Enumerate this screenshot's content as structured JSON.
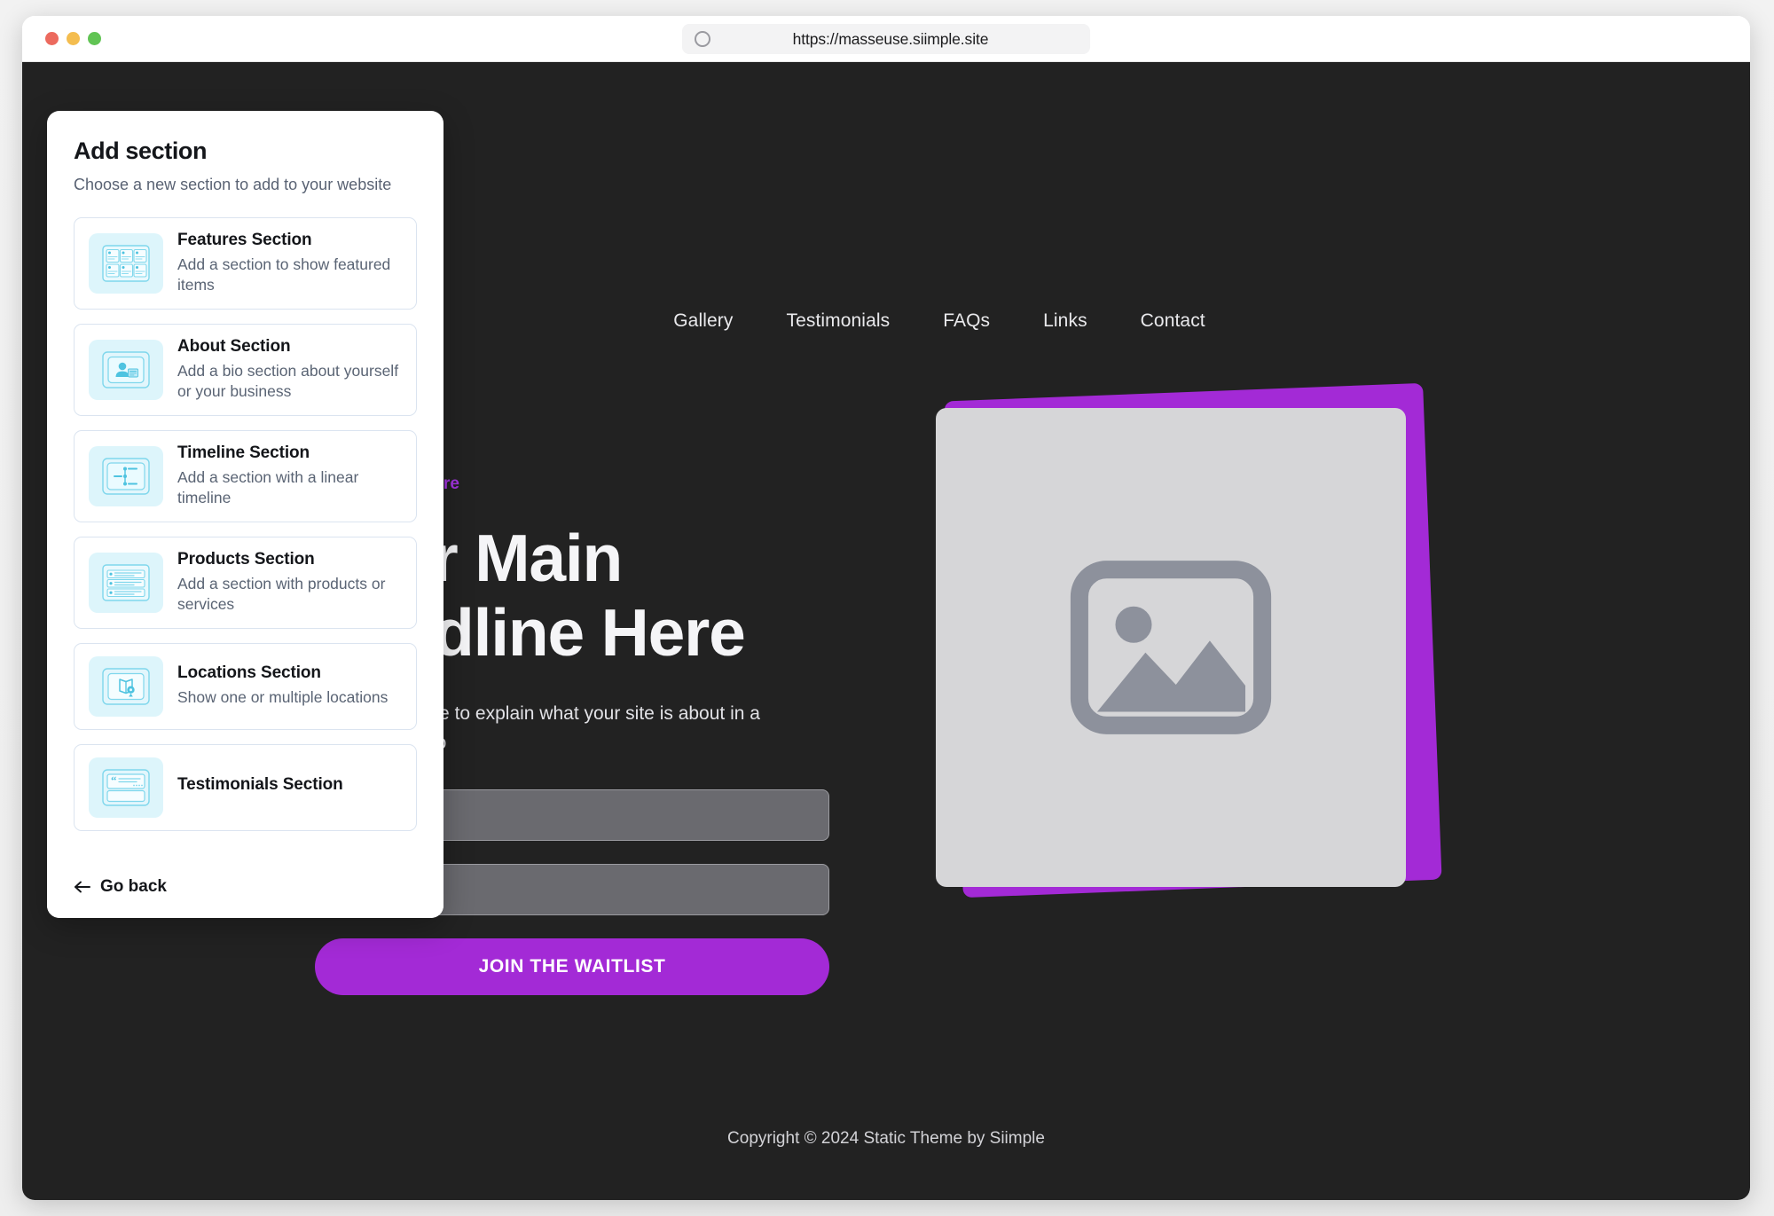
{
  "browser": {
    "url": "https://masseuse.siimple.site",
    "traffic_lights": [
      "close-red",
      "minimize-yellow",
      "maximize-green"
    ],
    "reload_icon": "circle-icon"
  },
  "site": {
    "nav": [
      {
        "label": "Gallery"
      },
      {
        "label": "Testimonials"
      },
      {
        "label": "FAQs"
      },
      {
        "label": "Links"
      },
      {
        "label": "Contact"
      }
    ],
    "hero": {
      "eyebrow": "Your Tagline Here",
      "headline": "Your Main Headline Here",
      "subhead": "This is the place to explain what your site is about in a sentence or two",
      "field_one_value": "",
      "field_two_value": "",
      "cta_label": "JOIN THE WAITLIST",
      "image_placeholder_icon": "image-placeholder-icon"
    },
    "footer": {
      "copyright": "Copyright © 2024 Static Theme by Siimple"
    },
    "colors": {
      "background": "#222222",
      "accent": "#a32ad6",
      "eyebrow": "#a233e0",
      "field": "#6a6a6f",
      "image_card": "#d6d6d8"
    }
  },
  "panel": {
    "title": "Add section",
    "subtitle": "Choose a new section to add to your website",
    "back_label": "Go back",
    "back_icon": "arrow-left-icon",
    "sections": [
      {
        "name": "Features Section",
        "desc": "Add a section to show featured items",
        "icon": "features-grid-icon"
      },
      {
        "name": "About Section",
        "desc": "Add a bio section about yourself or your business",
        "icon": "person-card-icon"
      },
      {
        "name": "Timeline Section",
        "desc": "Add a section with a linear timeline",
        "icon": "timeline-icon"
      },
      {
        "name": "Products Section",
        "desc": "Add a section with products or services",
        "icon": "product-list-icon"
      },
      {
        "name": "Locations Section",
        "desc": "Show one or multiple locations",
        "icon": "map-pin-icon"
      },
      {
        "name": "Testimonials Section",
        "desc": "",
        "icon": "quote-card-icon"
      }
    ]
  }
}
